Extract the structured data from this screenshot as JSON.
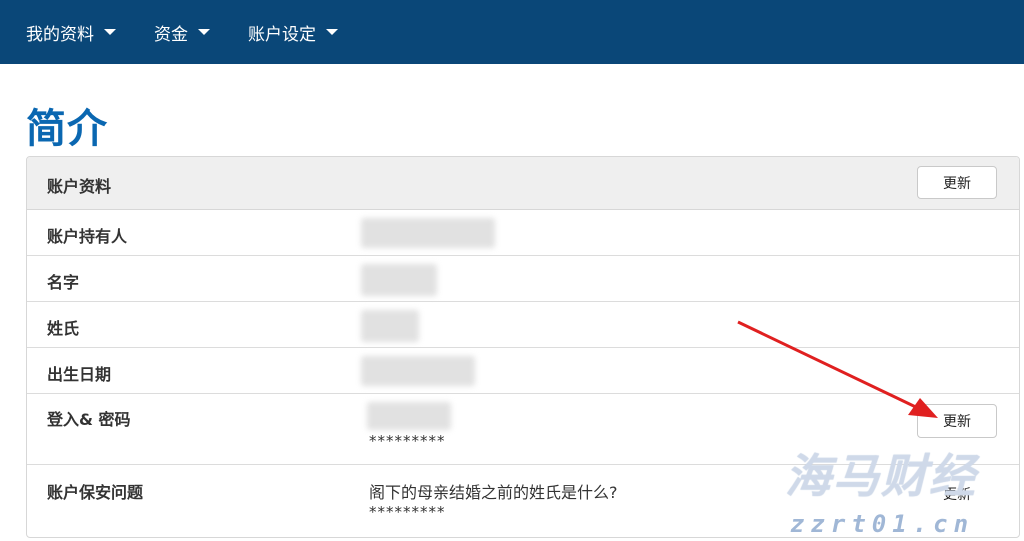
{
  "nav": {
    "items": [
      {
        "label": "我的资料"
      },
      {
        "label": "资金"
      },
      {
        "label": "账户设定"
      }
    ]
  },
  "page_title": "简介",
  "panel": {
    "title": "账户资料",
    "update_label": "更新",
    "rows": [
      {
        "label": "账户持有人"
      },
      {
        "label": "名字"
      },
      {
        "label": "姓氏"
      },
      {
        "label": "出生日期"
      },
      {
        "label": "登入& 密码",
        "masked": "*********",
        "update_label": "更新"
      },
      {
        "label": "账户保安问题",
        "question": "阁下的母亲结婚之前的姓氏是什么?",
        "masked": "*********",
        "update_label": "更新"
      }
    ]
  },
  "watermark": {
    "main": "海马财经",
    "sub": "zzrt01.cn"
  },
  "colors": {
    "nav_bg": "#0a4778",
    "title": "#0a67b1",
    "arrow": "#e02020"
  }
}
